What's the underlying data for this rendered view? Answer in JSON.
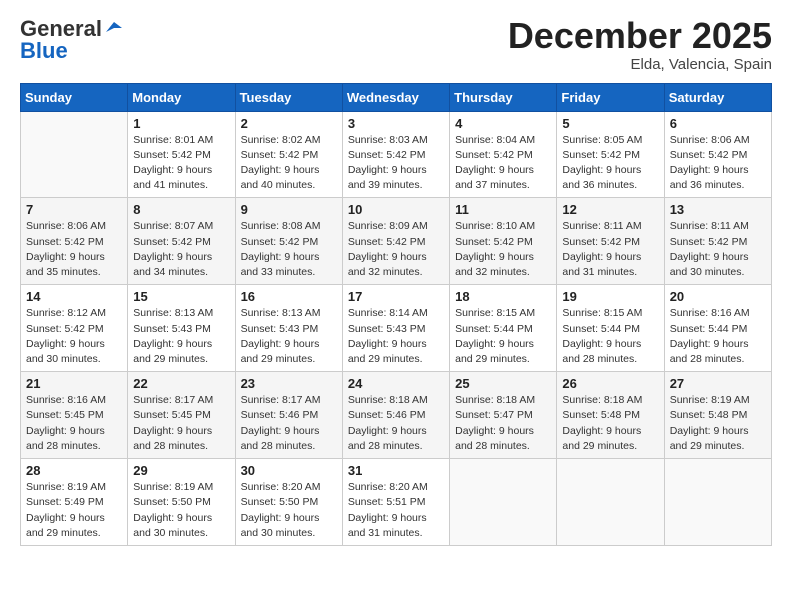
{
  "header": {
    "logo_general": "General",
    "logo_blue": "Blue",
    "month_title": "December 2025",
    "location": "Elda, Valencia, Spain"
  },
  "days_of_week": [
    "Sunday",
    "Monday",
    "Tuesday",
    "Wednesday",
    "Thursday",
    "Friday",
    "Saturday"
  ],
  "weeks": [
    [
      {
        "day": "",
        "sunrise": "",
        "sunset": "",
        "daylight": ""
      },
      {
        "day": "1",
        "sunrise": "Sunrise: 8:01 AM",
        "sunset": "Sunset: 5:42 PM",
        "daylight": "Daylight: 9 hours and 41 minutes."
      },
      {
        "day": "2",
        "sunrise": "Sunrise: 8:02 AM",
        "sunset": "Sunset: 5:42 PM",
        "daylight": "Daylight: 9 hours and 40 minutes."
      },
      {
        "day": "3",
        "sunrise": "Sunrise: 8:03 AM",
        "sunset": "Sunset: 5:42 PM",
        "daylight": "Daylight: 9 hours and 39 minutes."
      },
      {
        "day": "4",
        "sunrise": "Sunrise: 8:04 AM",
        "sunset": "Sunset: 5:42 PM",
        "daylight": "Daylight: 9 hours and 37 minutes."
      },
      {
        "day": "5",
        "sunrise": "Sunrise: 8:05 AM",
        "sunset": "Sunset: 5:42 PM",
        "daylight": "Daylight: 9 hours and 36 minutes."
      },
      {
        "day": "6",
        "sunrise": "Sunrise: 8:06 AM",
        "sunset": "Sunset: 5:42 PM",
        "daylight": "Daylight: 9 hours and 36 minutes."
      }
    ],
    [
      {
        "day": "7",
        "sunrise": "Sunrise: 8:06 AM",
        "sunset": "Sunset: 5:42 PM",
        "daylight": "Daylight: 9 hours and 35 minutes."
      },
      {
        "day": "8",
        "sunrise": "Sunrise: 8:07 AM",
        "sunset": "Sunset: 5:42 PM",
        "daylight": "Daylight: 9 hours and 34 minutes."
      },
      {
        "day": "9",
        "sunrise": "Sunrise: 8:08 AM",
        "sunset": "Sunset: 5:42 PM",
        "daylight": "Daylight: 9 hours and 33 minutes."
      },
      {
        "day": "10",
        "sunrise": "Sunrise: 8:09 AM",
        "sunset": "Sunset: 5:42 PM",
        "daylight": "Daylight: 9 hours and 32 minutes."
      },
      {
        "day": "11",
        "sunrise": "Sunrise: 8:10 AM",
        "sunset": "Sunset: 5:42 PM",
        "daylight": "Daylight: 9 hours and 32 minutes."
      },
      {
        "day": "12",
        "sunrise": "Sunrise: 8:11 AM",
        "sunset": "Sunset: 5:42 PM",
        "daylight": "Daylight: 9 hours and 31 minutes."
      },
      {
        "day": "13",
        "sunrise": "Sunrise: 8:11 AM",
        "sunset": "Sunset: 5:42 PM",
        "daylight": "Daylight: 9 hours and 30 minutes."
      }
    ],
    [
      {
        "day": "14",
        "sunrise": "Sunrise: 8:12 AM",
        "sunset": "Sunset: 5:42 PM",
        "daylight": "Daylight: 9 hours and 30 minutes."
      },
      {
        "day": "15",
        "sunrise": "Sunrise: 8:13 AM",
        "sunset": "Sunset: 5:43 PM",
        "daylight": "Daylight: 9 hours and 29 minutes."
      },
      {
        "day": "16",
        "sunrise": "Sunrise: 8:13 AM",
        "sunset": "Sunset: 5:43 PM",
        "daylight": "Daylight: 9 hours and 29 minutes."
      },
      {
        "day": "17",
        "sunrise": "Sunrise: 8:14 AM",
        "sunset": "Sunset: 5:43 PM",
        "daylight": "Daylight: 9 hours and 29 minutes."
      },
      {
        "day": "18",
        "sunrise": "Sunrise: 8:15 AM",
        "sunset": "Sunset: 5:44 PM",
        "daylight": "Daylight: 9 hours and 29 minutes."
      },
      {
        "day": "19",
        "sunrise": "Sunrise: 8:15 AM",
        "sunset": "Sunset: 5:44 PM",
        "daylight": "Daylight: 9 hours and 28 minutes."
      },
      {
        "day": "20",
        "sunrise": "Sunrise: 8:16 AM",
        "sunset": "Sunset: 5:44 PM",
        "daylight": "Daylight: 9 hours and 28 minutes."
      }
    ],
    [
      {
        "day": "21",
        "sunrise": "Sunrise: 8:16 AM",
        "sunset": "Sunset: 5:45 PM",
        "daylight": "Daylight: 9 hours and 28 minutes."
      },
      {
        "day": "22",
        "sunrise": "Sunrise: 8:17 AM",
        "sunset": "Sunset: 5:45 PM",
        "daylight": "Daylight: 9 hours and 28 minutes."
      },
      {
        "day": "23",
        "sunrise": "Sunrise: 8:17 AM",
        "sunset": "Sunset: 5:46 PM",
        "daylight": "Daylight: 9 hours and 28 minutes."
      },
      {
        "day": "24",
        "sunrise": "Sunrise: 8:18 AM",
        "sunset": "Sunset: 5:46 PM",
        "daylight": "Daylight: 9 hours and 28 minutes."
      },
      {
        "day": "25",
        "sunrise": "Sunrise: 8:18 AM",
        "sunset": "Sunset: 5:47 PM",
        "daylight": "Daylight: 9 hours and 28 minutes."
      },
      {
        "day": "26",
        "sunrise": "Sunrise: 8:18 AM",
        "sunset": "Sunset: 5:48 PM",
        "daylight": "Daylight: 9 hours and 29 minutes."
      },
      {
        "day": "27",
        "sunrise": "Sunrise: 8:19 AM",
        "sunset": "Sunset: 5:48 PM",
        "daylight": "Daylight: 9 hours and 29 minutes."
      }
    ],
    [
      {
        "day": "28",
        "sunrise": "Sunrise: 8:19 AM",
        "sunset": "Sunset: 5:49 PM",
        "daylight": "Daylight: 9 hours and 29 minutes."
      },
      {
        "day": "29",
        "sunrise": "Sunrise: 8:19 AM",
        "sunset": "Sunset: 5:50 PM",
        "daylight": "Daylight: 9 hours and 30 minutes."
      },
      {
        "day": "30",
        "sunrise": "Sunrise: 8:20 AM",
        "sunset": "Sunset: 5:50 PM",
        "daylight": "Daylight: 9 hours and 30 minutes."
      },
      {
        "day": "31",
        "sunrise": "Sunrise: 8:20 AM",
        "sunset": "Sunset: 5:51 PM",
        "daylight": "Daylight: 9 hours and 31 minutes."
      },
      {
        "day": "",
        "sunrise": "",
        "sunset": "",
        "daylight": ""
      },
      {
        "day": "",
        "sunrise": "",
        "sunset": "",
        "daylight": ""
      },
      {
        "day": "",
        "sunrise": "",
        "sunset": "",
        "daylight": ""
      }
    ]
  ]
}
